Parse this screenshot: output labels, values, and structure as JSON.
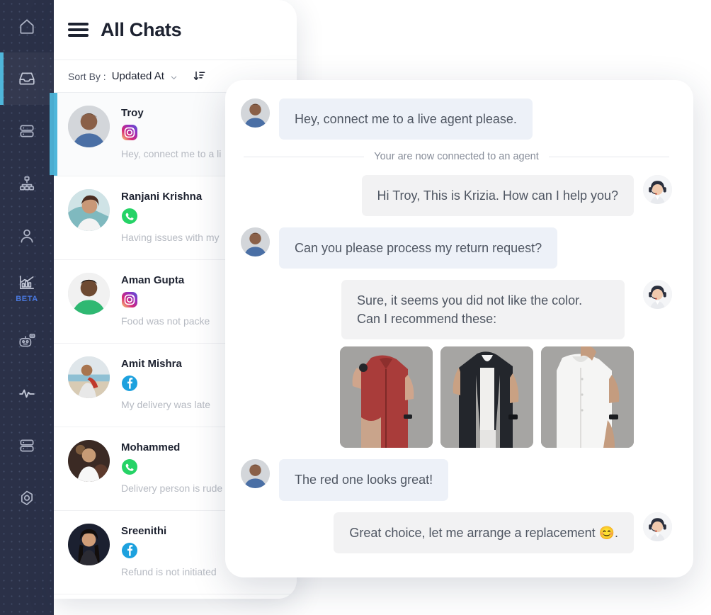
{
  "theme": {
    "accent": "#4fb6da",
    "sidebar_bg": "#2b3148",
    "beta_color": "#4a79e0",
    "bubble_in": "#edf1f8",
    "bubble_out": "#f2f2f3",
    "text_dark": "#1d2230",
    "text_muted": "#b6bac2"
  },
  "sidebar": {
    "items": [
      {
        "icon": "home-icon",
        "label": "Home",
        "active": false,
        "badge": ""
      },
      {
        "icon": "inbox-icon",
        "label": "Inbox",
        "active": true,
        "badge": ""
      },
      {
        "icon": "database-icon",
        "label": "Data",
        "active": false,
        "badge": ""
      },
      {
        "icon": "sitemap-icon",
        "label": "Flows",
        "active": false,
        "badge": ""
      },
      {
        "icon": "user-icon",
        "label": "Contacts",
        "active": false,
        "badge": ""
      },
      {
        "icon": "analytics-icon",
        "label": "Analytics",
        "active": false,
        "badge": "BETA"
      },
      {
        "icon": "robot-icon",
        "label": "Bot",
        "active": false,
        "badge": ""
      },
      {
        "icon": "activity-icon",
        "label": "Activity",
        "active": false,
        "badge": ""
      },
      {
        "icon": "database-icon",
        "label": "Storage",
        "active": false,
        "badge": ""
      },
      {
        "icon": "gear-icon",
        "label": "Settings",
        "active": false,
        "badge": ""
      }
    ]
  },
  "chat_list": {
    "title": "All Chats",
    "menu_icon": "hamburger-icon",
    "sort": {
      "label": "Sort By :",
      "value": "Updated At",
      "chevron_icon": "chevron-down-icon",
      "order_icon": "sort-descending-icon"
    },
    "items": [
      {
        "name": "Troy",
        "channel": "instagram",
        "snippet": "Hey, connect me to a li",
        "selected": true,
        "avatar": "man-blue-tshirt"
      },
      {
        "name": "Ranjani Krishna",
        "channel": "whatsapp",
        "snippet": "Having issues with my",
        "selected": false,
        "avatar": "woman-white-top"
      },
      {
        "name": "Aman Gupta",
        "channel": "instagram",
        "snippet": "Food was not packe",
        "selected": false,
        "avatar": "man-green-shirt"
      },
      {
        "name": "Amit Mishra",
        "channel": "facebook",
        "snippet": "My delivery was late",
        "selected": false,
        "avatar": "man-beach"
      },
      {
        "name": "Mohammed",
        "channel": "whatsapp",
        "snippet": "Delivery person is rude",
        "selected": false,
        "avatar": "person-white-outfit"
      },
      {
        "name": "Sreenithi",
        "channel": "facebook",
        "snippet": "Refund is not initiated",
        "selected": false,
        "avatar": "woman-dark-hair"
      }
    ]
  },
  "conversation": {
    "messages": [
      {
        "from": "customer",
        "avatar": "man-blue-tshirt",
        "text": "Hey, connect me to a live agent please.",
        "type": "text"
      },
      {
        "from": "system",
        "text": "Your are now connected to an agent",
        "type": "divider"
      },
      {
        "from": "agent",
        "avatar": "agent-headset",
        "text": "Hi Troy, This is Krizia. How can I help you?",
        "type": "text"
      },
      {
        "from": "customer",
        "avatar": "man-blue-tshirt",
        "text": "Can you please process my return request?",
        "type": "text"
      },
      {
        "from": "agent",
        "avatar": "agent-headset",
        "text": "Sure, it seems you did not like the color. Can I recommend these:",
        "type": "text-with-products",
        "products": [
          {
            "name": "red-shirt",
            "color": "#a93c3a"
          },
          {
            "name": "black-shirt",
            "color": "#23262c"
          },
          {
            "name": "white-shirt",
            "color": "#f4f4f4"
          }
        ]
      },
      {
        "from": "customer",
        "avatar": "man-blue-tshirt",
        "text": "The red one looks great!",
        "type": "text"
      },
      {
        "from": "agent",
        "avatar": "agent-headset",
        "text": "Great choice, let me arrange a replacement 😊.",
        "type": "text"
      }
    ]
  }
}
